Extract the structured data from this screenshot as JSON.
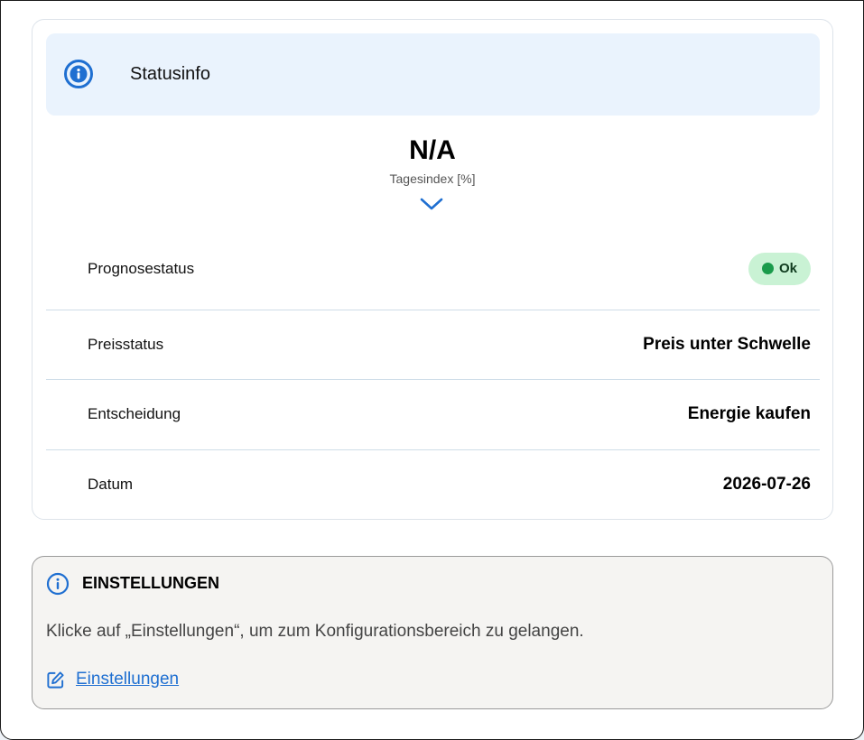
{
  "colors": {
    "accent": "#1f6fd1",
    "header_bg": "#eaf3fd",
    "ok_badge_bg": "#c9f2d4",
    "ok_dot": "#1a9b4b",
    "settings_bg": "#f5f4f2"
  },
  "status_card": {
    "header": {
      "icon": "info-circle-icon",
      "title": "Statusinfo"
    },
    "metric": {
      "value": "N/A",
      "label": "Tagesindex [%]",
      "expand_icon": "chevron-down-icon"
    },
    "rows": [
      {
        "label": "Prognosestatus",
        "badge": "Ok"
      },
      {
        "label": "Preisstatus",
        "value": "Preis unter Schwelle"
      },
      {
        "label": "Entscheidung",
        "value": "Energie kaufen"
      },
      {
        "label": "Datum",
        "value": "2026-07-26"
      }
    ]
  },
  "settings_card": {
    "icon": "info-circle-icon",
    "title": "EINSTELLUNGEN",
    "description": "Klicke auf „Einstellungen“, um zum Konfigurationsbereich zu gelangen.",
    "link": {
      "icon": "edit-icon",
      "label": "Einstellungen"
    }
  }
}
